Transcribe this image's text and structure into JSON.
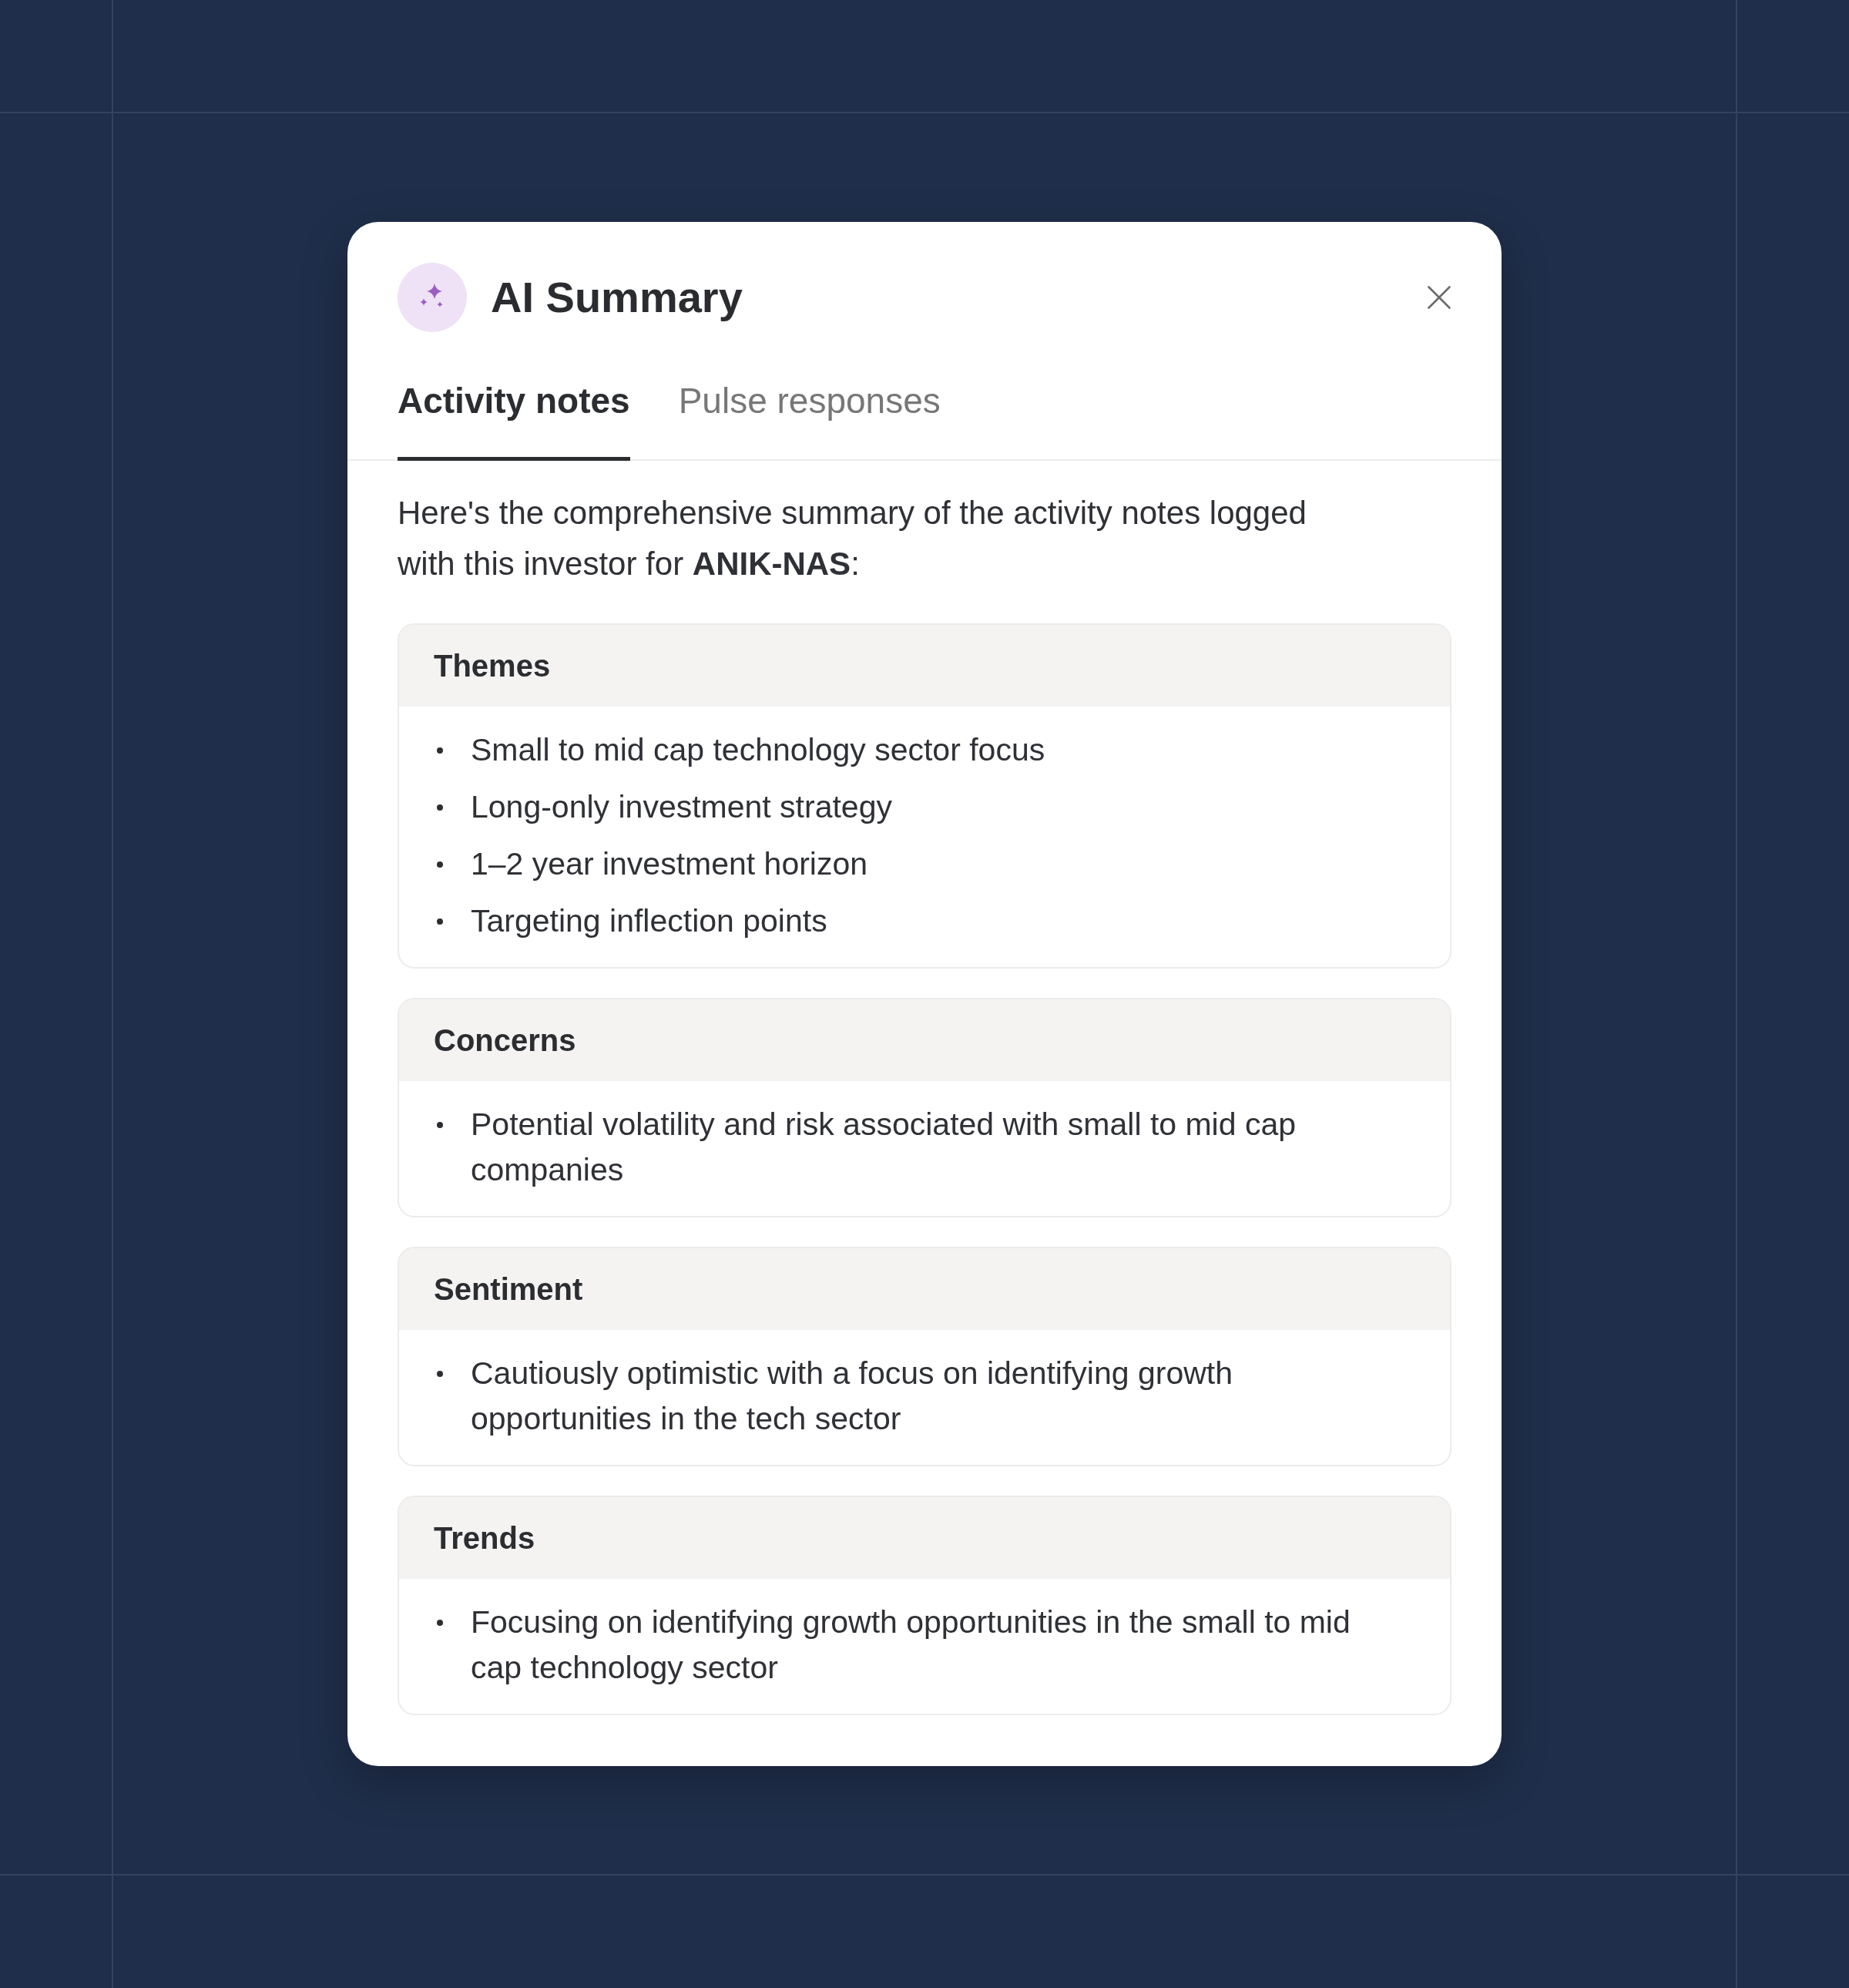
{
  "dialog": {
    "title": "AI Summary"
  },
  "tabs": [
    {
      "label": "Activity notes",
      "selected": true
    },
    {
      "label": "Pulse responses",
      "selected": false
    }
  ],
  "intro": "Here's the comprehensive summary of the activity notes logged with this investor for **ANIK-NAS**:",
  "sections": [
    {
      "title": "Themes",
      "items": [
        "Small to mid cap technology sector focus",
        "Long-only investment strategy",
        "1–2 year investment horizon",
        "Targeting inflection points"
      ]
    },
    {
      "title": "Concerns",
      "items": [
        "Potential volatility and risk associated with small to mid cap companies"
      ]
    },
    {
      "title": "Sentiment",
      "items": [
        "Cautiously optimistic with a focus on identifying growth opportunities in the tech sector"
      ]
    },
    {
      "title": "Trends",
      "items": [
        "Focusing on identifying growth opportunities in the small to mid cap technology sector"
      ]
    }
  ]
}
